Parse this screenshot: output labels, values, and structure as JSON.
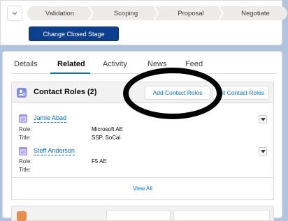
{
  "path": {
    "stages": [
      "Validation",
      "Scoping",
      "Proposal",
      "Negotiate"
    ],
    "primary_action": "Change Closed Stage",
    "chevron": "chevron-down-icon"
  },
  "tabs": {
    "items": [
      "Details",
      "Related",
      "Activity",
      "News",
      "Feed"
    ],
    "active": "Related"
  },
  "contact_roles": {
    "title": "Contact Roles (2)",
    "add_button": "Add Contact Roles",
    "edit_button_visible": "it Contact Roles",
    "view_all": "View All",
    "labels": {
      "role": "Role:",
      "title": "Title:"
    },
    "contacts": [
      {
        "name": "Jamie Abad",
        "role": "Microsoft AE",
        "title": "SSP, SoCal"
      },
      {
        "name": "Steff Anderson",
        "role": "F5 AE",
        "title": ""
      }
    ]
  },
  "colors": {
    "brand_blue": "#0070d2",
    "primary_button": "#0d3f8f",
    "contact_roles_icon": "#7f8de1",
    "contact_icon": "#a094ed",
    "next_list_icon": "#e88e4d",
    "annotation": "#000000"
  }
}
